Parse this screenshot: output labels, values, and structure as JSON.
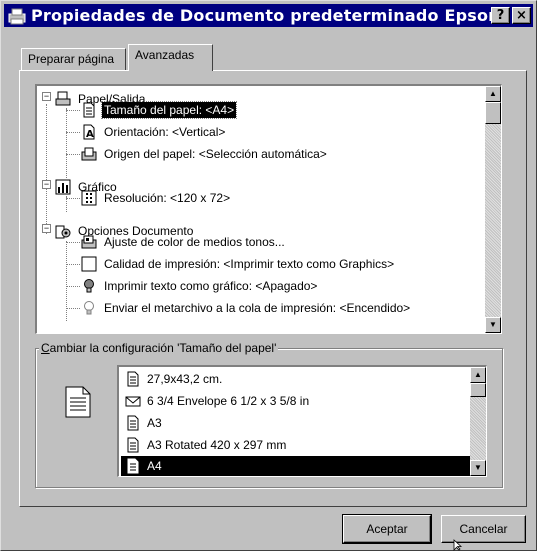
{
  "window": {
    "title": "Propiedades de Documento predeterminado Epson ...",
    "help_label": "?",
    "close_label": "×"
  },
  "tabs": [
    {
      "label": "Preparar página",
      "active": false
    },
    {
      "label": "Avanzadas",
      "active": true
    }
  ],
  "tree": {
    "items": [
      {
        "label": "Papel/Salida",
        "icon": "printer-paper-icon"
      },
      {
        "label": "Tamaño del papel: <A4>",
        "icon": "document-icon",
        "selected": true
      },
      {
        "label": "Orientación: <Vertical>",
        "icon": "orientation-icon"
      },
      {
        "label": "Origen del papel: <Selección automática>",
        "icon": "paper-tray-icon"
      },
      {
        "label": "Gráfico",
        "icon": "chart-icon"
      },
      {
        "label": "Resolución: <120 x 72>",
        "icon": "resolution-icon"
      },
      {
        "label": "Opciones Documento",
        "icon": "document-options-icon"
      },
      {
        "label": "Ajuste de color de medios tonos...",
        "icon": "color-adjust-icon"
      },
      {
        "label": "Calidad de impresión: <Imprimir texto como Graphics>",
        "icon": "blank-box-icon"
      },
      {
        "label": "Imprimir texto como gráfico: <Apagado>",
        "icon": "lightbulb-off-icon"
      },
      {
        "label": "Enviar el metarchivo a la cola de impresión: <Encendido>",
        "icon": "lightbulb-on-icon"
      }
    ]
  },
  "change_group": {
    "label_prefix": "",
    "label_access_key": "C",
    "label_rest": "ambiar la configuración 'Tamaño del papel'",
    "options": [
      {
        "label": "27,9x43,2 cm.",
        "icon": "document-icon"
      },
      {
        "label": "6 3/4 Envelope 6 1/2 x 3 5/8 in",
        "icon": "envelope-icon"
      },
      {
        "label": "A3",
        "icon": "document-icon"
      },
      {
        "label": "A3 Rotated 420 x 297 mm",
        "icon": "document-icon"
      },
      {
        "label": "A4",
        "icon": "document-icon",
        "selected": true
      }
    ]
  },
  "buttons": {
    "ok": "Aceptar",
    "cancel": "Cancelar"
  }
}
